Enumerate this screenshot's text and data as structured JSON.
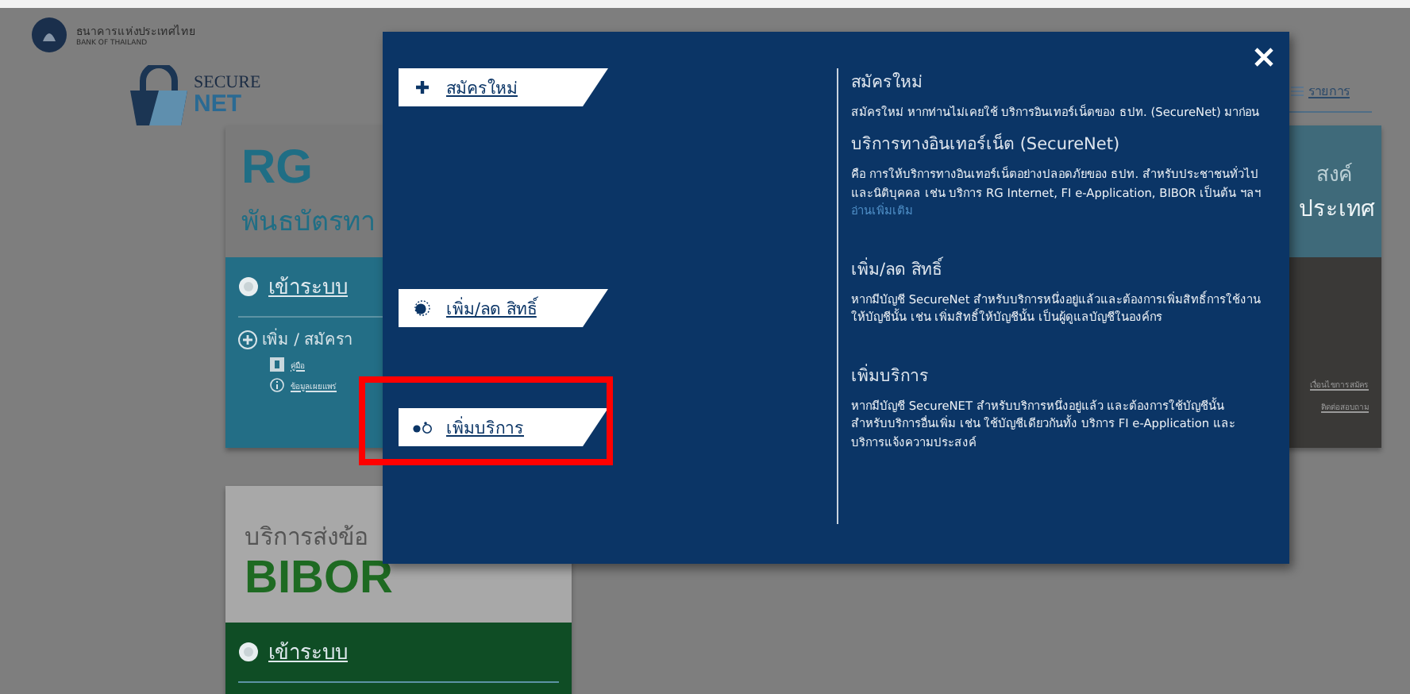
{
  "header": {
    "org_name_th": "ธนาคารแห่งประเทศไทย",
    "org_name_en": "BANK OF THAILAND",
    "product_logo": {
      "line_1": "SECURE",
      "line_2": "NET"
    }
  },
  "nav": {
    "menu_label": "รายการ"
  },
  "rg_card": {
    "title": "RG",
    "subtitle": "พันธบัตรทา",
    "login": "เข้าระบบ",
    "add": "เพิ่ม / สมัครา",
    "links": [
      {
        "kind": "manual",
        "label": "คู่มือ"
      },
      {
        "kind": "info",
        "label": "ข้อมูลเผยแพร่"
      }
    ]
  },
  "right_card": {
    "line_1": "สงค์",
    "line_2": "ประเทศ",
    "links": [
      "เงื่อนไขการสมัคร",
      "ติดต่อสอบถาม"
    ]
  },
  "bibor_card": {
    "subtitle": "บริการส่งข้อ",
    "title": "BIBOR",
    "login": "เข้าระบบ"
  },
  "modal": {
    "menu": [
      {
        "kind": "plus",
        "label": "สมัครใหม่",
        "highlighted": false
      },
      {
        "kind": "ring-dot",
        "label": "เพิ่ม/ลด สิทธิ์",
        "highlighted": false
      },
      {
        "kind": "linked-dots",
        "label": "เพิ่มบริการ",
        "highlighted": true
      }
    ],
    "sections": [
      {
        "heading": "สมัครใหม่",
        "body": "สมัครใหม่ หากท่านไม่เคยใช้ บริการอินเทอร์เน็ตของ ธปท. (SecureNet) มาก่อน"
      },
      {
        "heading": "บริการทางอินเทอร์เน็ต (SecureNet)",
        "body": "คือ การให้บริการทางอินเทอร์เน็ตอย่างปลอดภัยของ ธปท. สำหรับประชาชนทั่วไป และนิติบุคคล เช่น บริการ RG Internet, FI e-Application, BIBOR เป็นต้น ฯลฯ",
        "link": "อ่านเพิ่มเติม"
      },
      {
        "heading": "เพิ่ม/ลด สิทธิ์",
        "body": "หากมีบัญชี SecureNet สำหรับบริการหนึ่งอยู่แล้วและต้องการเพิ่มสิทธิ์การใช้งานให้บัญชีนั้น เช่น เพิ่มสิทธิ์ให้บัญชีนั้น เป็นผู้ดูแลบัญชีในองค์กร"
      },
      {
        "heading": "เพิ่มบริการ",
        "body": "หากมีบัญชี SecureNET สำหรับบริการหนึ่งอยู่แล้ว และต้องการใช้บัญชีนั้น สำหรับบริการอื่นเพิ่ม เช่น ใช้บัญชีเดียวกันทั้ง บริการ FI e-Application และ บริการแจ้งความประสงค์"
      }
    ]
  }
}
